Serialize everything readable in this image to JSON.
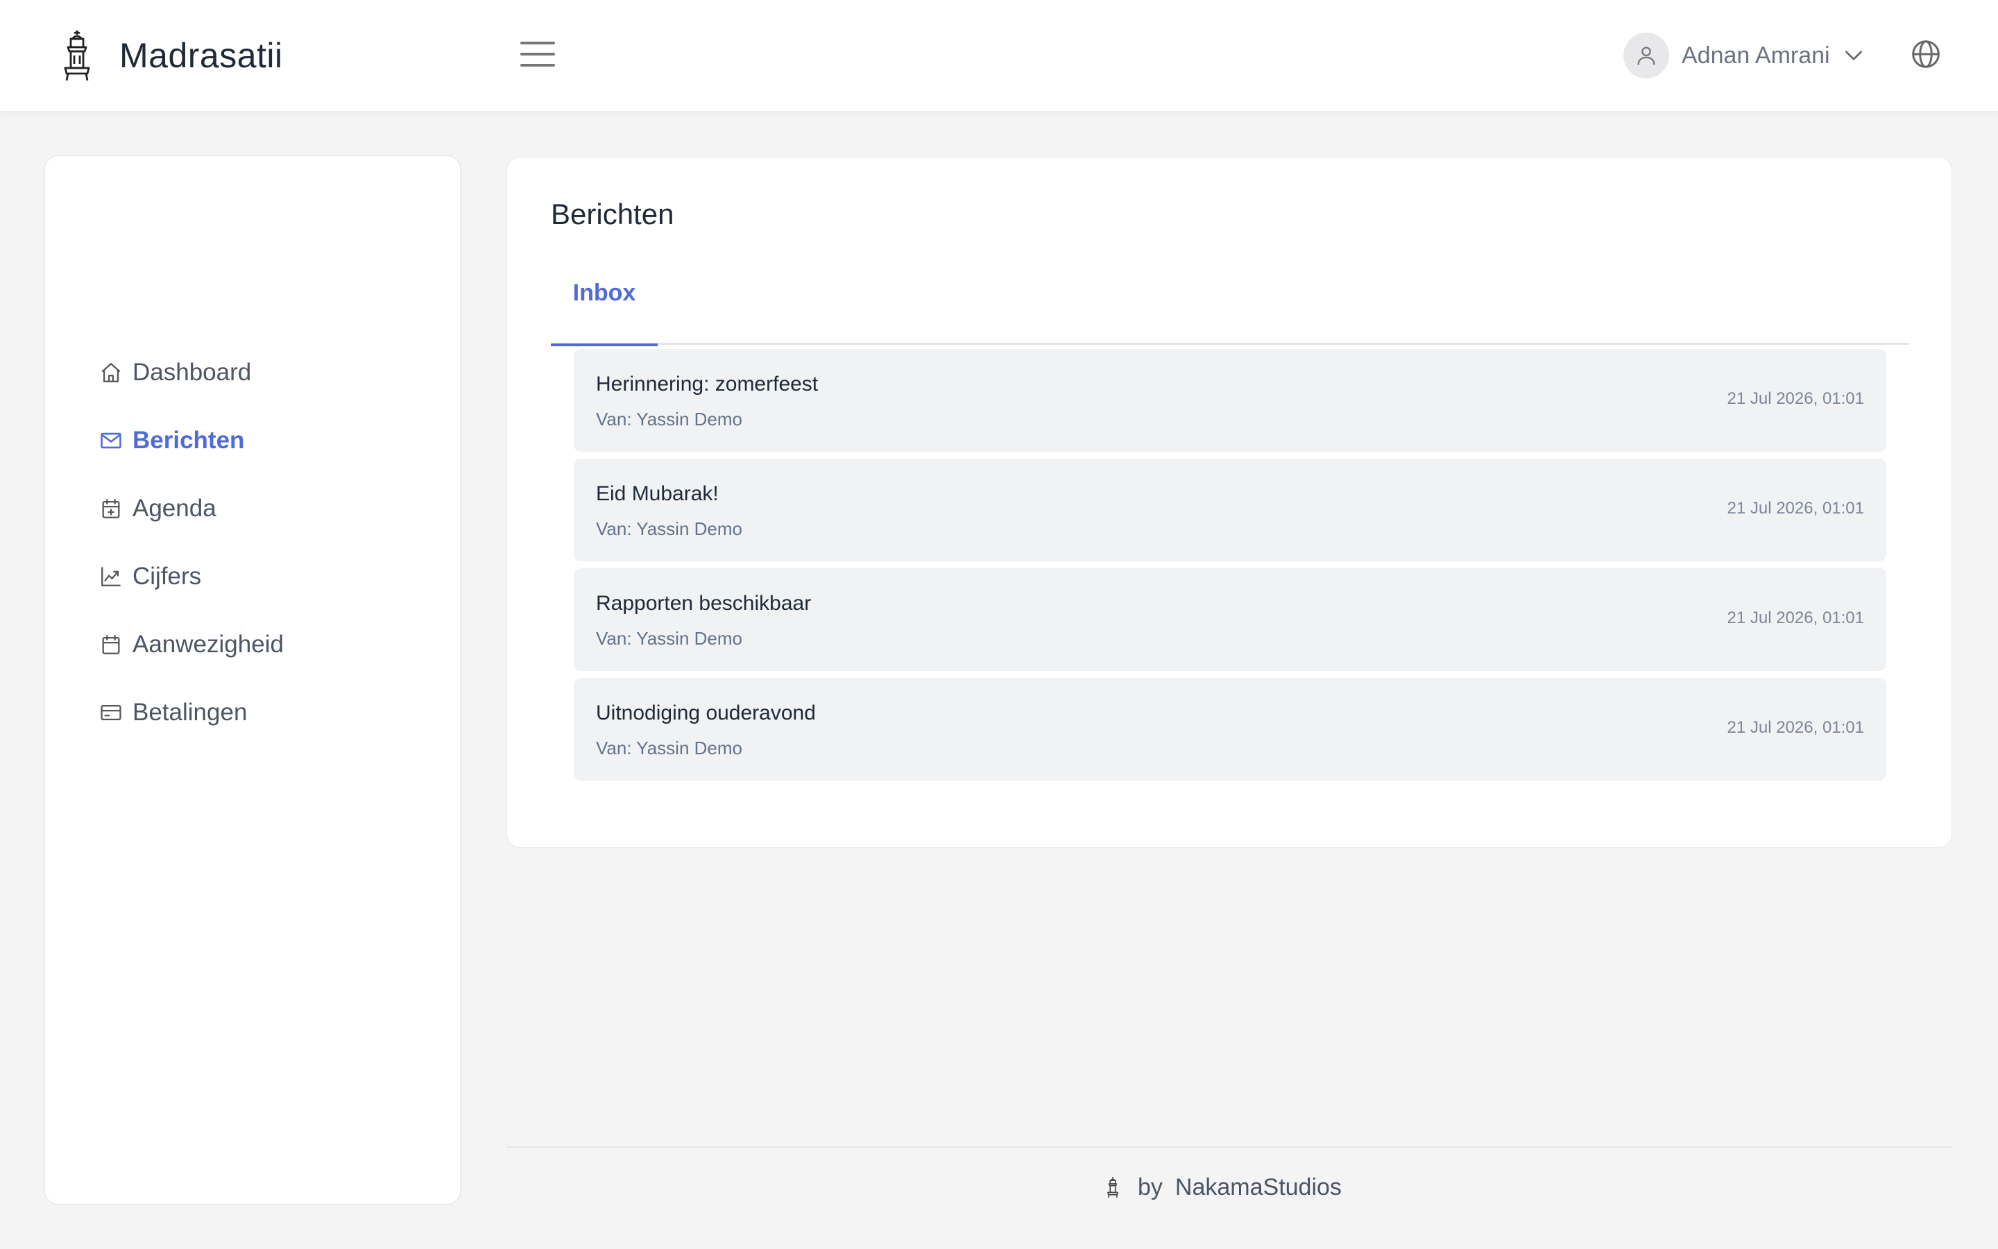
{
  "app": {
    "name": "Madrasatii"
  },
  "header": {
    "user_name": "Adnan Amrani"
  },
  "sidebar": {
    "items": [
      {
        "label": "Dashboard",
        "icon": "home-icon",
        "active": false
      },
      {
        "label": "Berichten",
        "icon": "mail-icon",
        "active": true
      },
      {
        "label": "Agenda",
        "icon": "calendar-plus-icon",
        "active": false
      },
      {
        "label": "Cijfers",
        "icon": "chart-line-icon",
        "active": false
      },
      {
        "label": "Aanwezigheid",
        "icon": "calendar-icon",
        "active": false
      },
      {
        "label": "Betalingen",
        "icon": "credit-card-icon",
        "active": false
      }
    ]
  },
  "main": {
    "title": "Berichten",
    "tabs": [
      {
        "label": "Inbox",
        "active": true
      }
    ],
    "messages": [
      {
        "subject": "Herinnering: zomerfeest",
        "from": "Van: Yassin Demo",
        "date": "21 Jul 2026, 01:01"
      },
      {
        "subject": "Eid Mubarak!",
        "from": "Van: Yassin Demo",
        "date": "21 Jul 2026, 01:01"
      },
      {
        "subject": "Rapporten beschikbaar",
        "from": "Van: Yassin Demo",
        "date": "21 Jul 2026, 01:01"
      },
      {
        "subject": "Uitnodiging ouderavond",
        "from": "Van: Yassin Demo",
        "date": "21 Jul 2026, 01:01"
      }
    ]
  },
  "footer": {
    "by": "by",
    "company": "NakamaStudios"
  },
  "colors": {
    "accent": "#4f6bd8",
    "background": "#f4f4f5",
    "message_bg": "#f1f2f4"
  }
}
